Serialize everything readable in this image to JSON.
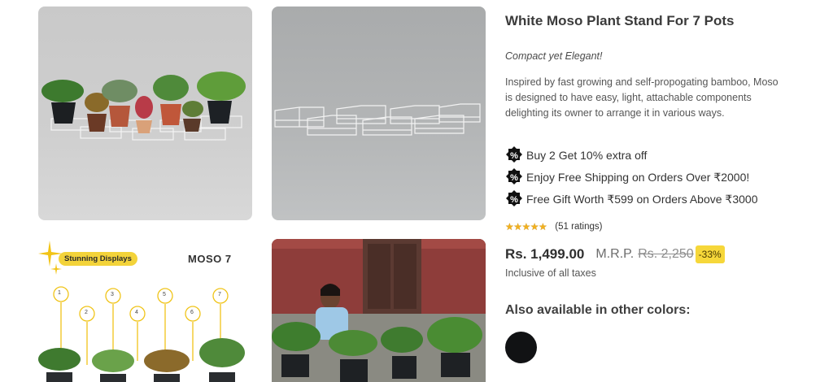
{
  "gallery": {
    "image3": {
      "badge": "Stunning Displays",
      "brand": "MOSO 7",
      "markers": [
        "1",
        "2",
        "3",
        "4",
        "5",
        "6",
        "7"
      ]
    }
  },
  "product": {
    "title": "White Moso Plant Stand For 7 Pots",
    "tagline": "Compact yet Elegant!",
    "description": "Inspired by fast growing and self-propogating bamboo, Moso is designed to have easy, light, attachable components delighting its owner to arrange it in various ways.",
    "offers": [
      "Buy 2 Get 10% extra off",
      "Enjoy Free Shipping on Orders Over ₹2000!",
      "Free Gift Worth ₹599 on Orders Above ₹3000"
    ],
    "rating": {
      "stars": 5,
      "count_text": "(51 ratings)"
    },
    "price": "Rs. 1,499.00",
    "mrp_label": "M.R.P.",
    "mrp_value": "Rs. 2,250",
    "discount": "-33%",
    "tax_note": "Inclusive of all taxes",
    "colors_title": "Also available in other colors:",
    "colors": [
      "#111214"
    ]
  }
}
